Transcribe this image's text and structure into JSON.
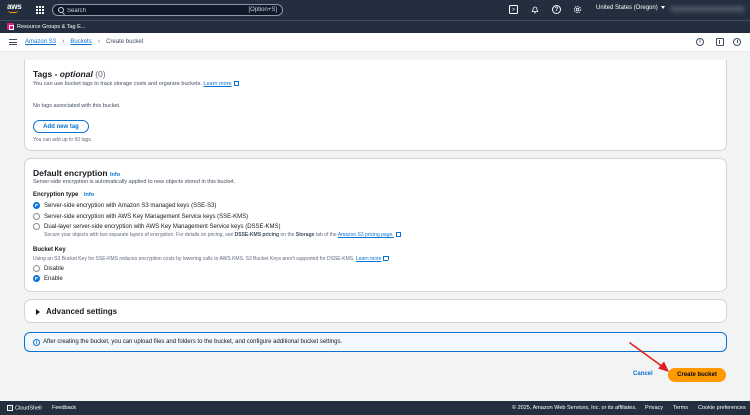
{
  "topnav": {
    "logo": "aws",
    "search_placeholder": "Search",
    "search_shortcut": "[Option+S]",
    "region": "United States (Oregon)",
    "icons": [
      "services-grid-icon",
      "cloudshell-icon",
      "notifications-bell-icon",
      "help-icon",
      "settings-gear-icon"
    ]
  },
  "favorites": {
    "item": "Resource Groups & Tag E..."
  },
  "breadcrumb": {
    "items": [
      "Amazon S3",
      "Buckets"
    ],
    "current": "Create bucket"
  },
  "tags": {
    "title_main": "Tags - ",
    "title_optional": "optional",
    "count": "(0)",
    "description": "You can use bucket tags to track storage costs and organize buckets.",
    "learn_more": "Learn more",
    "empty": "No tags associated with this bucket.",
    "add_button": "Add new tag",
    "limit": "You can add up to 50 tags."
  },
  "encryption": {
    "title": "Default encryption",
    "info": "Info",
    "description": "Server-side encryption is automatically applied to new objects stored in this bucket.",
    "type_label": "Encryption type",
    "type_info": "Info",
    "options": [
      {
        "label": "Server-side encryption with Amazon S3 managed keys (SSE-S3)",
        "selected": true
      },
      {
        "label": "Server-side encryption with AWS Key Management Service keys (SSE-KMS)",
        "selected": false
      },
      {
        "label": "Dual-layer server-side encryption with AWS Key Management Service keys (DSSE-KMS)",
        "selected": false
      }
    ],
    "dsse_desc_1": "Secure your objects with two separate layers of encryption. For details on pricing, see ",
    "dsse_desc_bold_1": "DSSE-KMS pricing",
    "dsse_desc_2": " on the ",
    "dsse_desc_bold_2": "Storage",
    "dsse_desc_3": " tab of the ",
    "dsse_pricing_link": "Amazon S3 pricing page.",
    "bucket_key_label": "Bucket Key",
    "bucket_key_desc": "Using an S3 Bucket Key for SSE-KMS reduces encryption costs by lowering calls to AWS KMS. S3 Bucket Keys aren't supported for DSSE-KMS.",
    "bucket_key_learn_more": "Learn more",
    "bucket_key_options": [
      {
        "label": "Disable",
        "selected": false
      },
      {
        "label": "Enable",
        "selected": true
      }
    ]
  },
  "advanced": {
    "title": "Advanced settings"
  },
  "alert": {
    "text": "After creating the bucket, you can upload files and folders to the bucket, and configure additional bucket settings."
  },
  "actions": {
    "cancel": "Cancel",
    "create": "Create bucket"
  },
  "footer": {
    "cloudshell": "CloudShell",
    "feedback": "Feedback",
    "copyright": "© 2025, Amazon Web Services, Inc. or its affiliates.",
    "privacy": "Privacy",
    "terms": "Terms",
    "cookies": "Cookie preferences"
  },
  "colors": {
    "nav_bg": "#232f3e",
    "link": "#0972d3",
    "primary_button": "#ff9900",
    "annotation_arrow": "#e02020"
  }
}
